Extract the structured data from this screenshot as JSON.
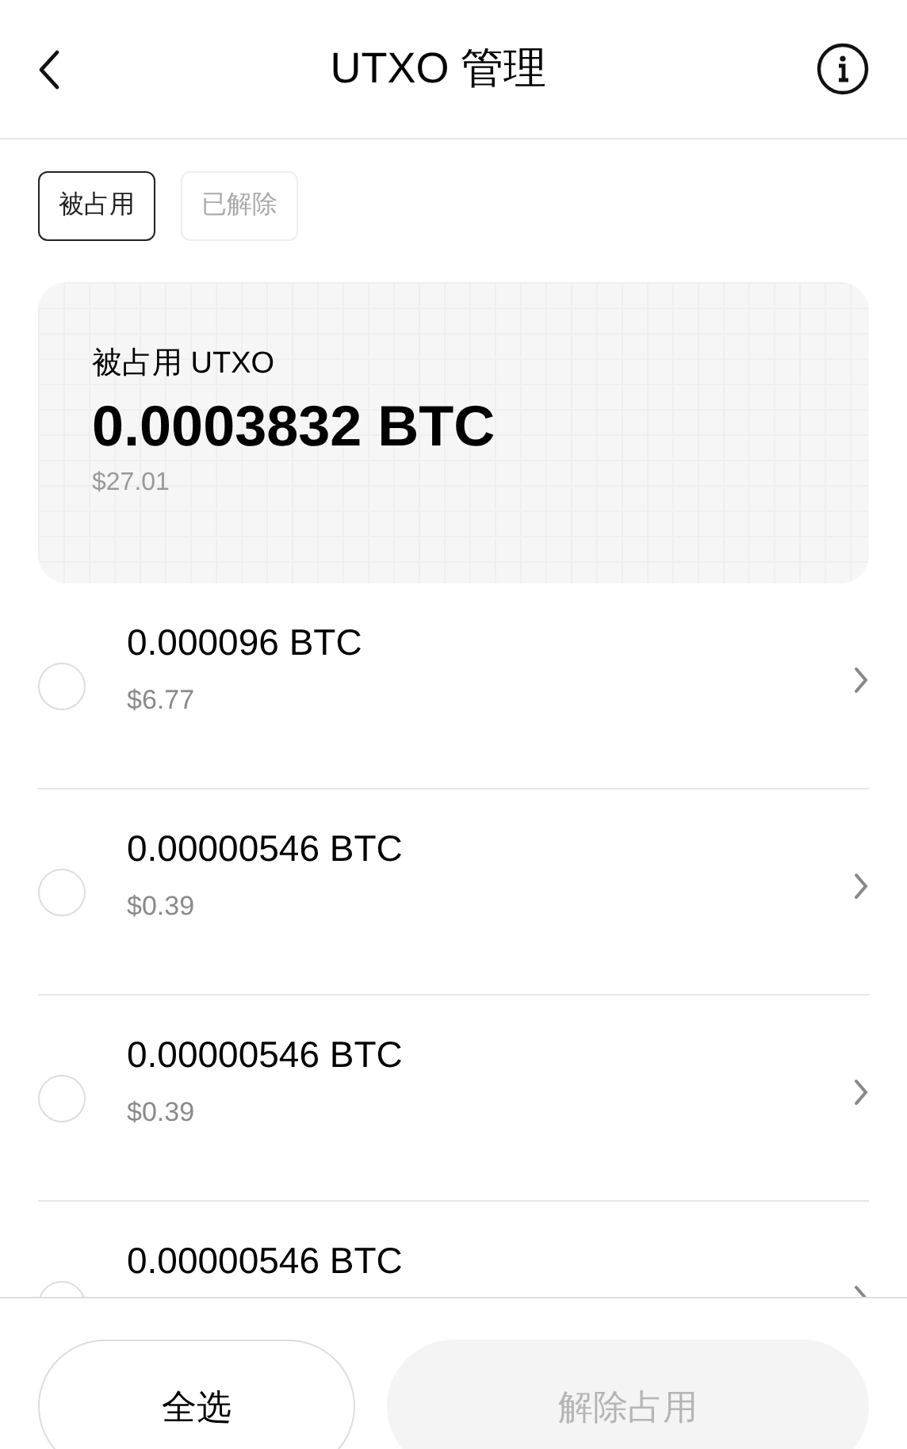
{
  "header": {
    "title": "UTXO 管理"
  },
  "tabs": [
    {
      "label": "被占用",
      "selected": true
    },
    {
      "label": "已解除",
      "selected": false
    }
  ],
  "summary": {
    "label": "被占用 UTXO",
    "amount": "0.0003832 BTC",
    "usd": "$27.01"
  },
  "utxos": [
    {
      "amount": "0.000096 BTC",
      "usd": "$6.77",
      "selected": false
    },
    {
      "amount": "0.00000546 BTC",
      "usd": "$0.39",
      "selected": false
    },
    {
      "amount": "0.00000546 BTC",
      "usd": "$0.39",
      "selected": false
    },
    {
      "amount": "0.00000546 BTC",
      "selected": false
    }
  ],
  "footer": {
    "select_all": "全选",
    "release": {
      "label": "解除占用",
      "disabled": true
    }
  }
}
